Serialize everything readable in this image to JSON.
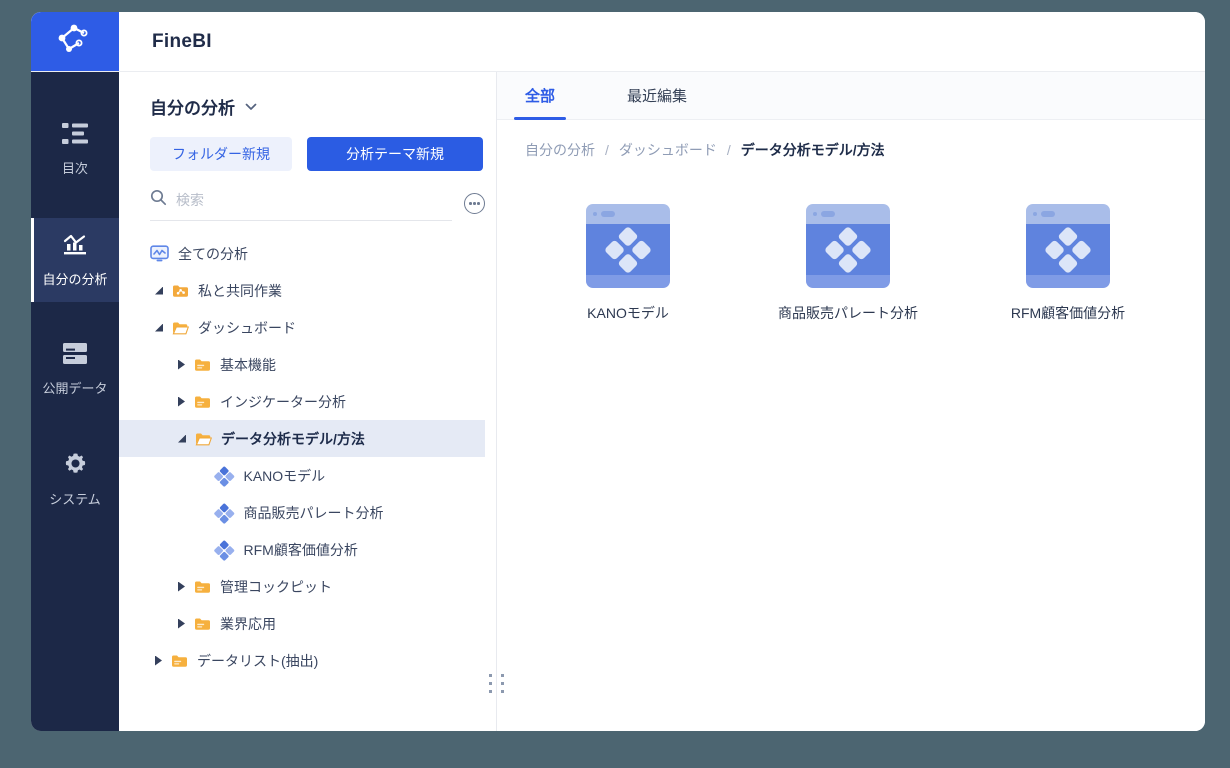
{
  "app": {
    "title": "FineBI"
  },
  "colors": {
    "accent_blue": "#2e5ce6",
    "sidebar_bg": "#1c2847",
    "sidebar_active_bg": "#2b3a63",
    "desktop_bg": "#4c6571",
    "folder_orange": "#f6b03e",
    "selected_row_bg": "#e5eaf5",
    "card_body_blue": "#5f83de"
  },
  "sidebar": {
    "items": [
      {
        "label": "目次",
        "icon": "toc-icon",
        "active": false
      },
      {
        "label": "自分の分析",
        "icon": "my-analysis-chart-icon",
        "active": true
      },
      {
        "label": "公開データ",
        "icon": "public-data-stack-icon",
        "active": false
      },
      {
        "label": "システム",
        "icon": "system-gear-icon",
        "active": false
      }
    ]
  },
  "panel": {
    "title": "自分の分析",
    "new_folder_label": "フォルダー新規",
    "new_theme_label": "分析テーマ新規",
    "search_placeholder": "検索",
    "tree": [
      {
        "label": "全ての分析",
        "level": 0,
        "icon": "monitor-chart-icon",
        "state": "none",
        "selected": false
      },
      {
        "label": "私と共同作業",
        "level": 1,
        "icon": "shared-folder-icon",
        "state": "expanded",
        "selected": false
      },
      {
        "label": "ダッシュボード",
        "level": 1,
        "icon": "folder-open-icon",
        "state": "expanded",
        "selected": false
      },
      {
        "label": "基本機能",
        "level": 2,
        "icon": "folder-icon",
        "state": "collapsed",
        "selected": false
      },
      {
        "label": "インジケーター分析",
        "level": 2,
        "icon": "folder-icon",
        "state": "collapsed",
        "selected": false
      },
      {
        "label": "データ分析モデル/方法",
        "level": 2,
        "icon": "folder-open-icon",
        "state": "expanded",
        "selected": true
      },
      {
        "label": "KANOモデル",
        "level": 3,
        "icon": "analysis-theme-diamond-icon",
        "state": "none",
        "selected": false
      },
      {
        "label": "商品販売パレート分析",
        "level": 3,
        "icon": "analysis-theme-diamond-icon",
        "state": "none",
        "selected": false
      },
      {
        "label": "RFM顧客価値分析",
        "level": 3,
        "icon": "analysis-theme-diamond-icon",
        "state": "none",
        "selected": false
      },
      {
        "label": "管理コックピット",
        "level": 2,
        "icon": "folder-icon",
        "state": "collapsed",
        "selected": false
      },
      {
        "label": "業界応用",
        "level": 2,
        "icon": "folder-icon",
        "state": "collapsed",
        "selected": false
      },
      {
        "label": "データリスト(抽出)",
        "level": 1,
        "icon": "folder-icon",
        "state": "collapsed",
        "selected": false
      }
    ]
  },
  "main": {
    "tabs": [
      {
        "label": "全部",
        "active": true
      },
      {
        "label": "最近編集",
        "active": false
      }
    ],
    "breadcrumb": {
      "items": [
        "自分の分析",
        "ダッシュボード",
        "データ分析モデル/方法"
      ],
      "separator": "/"
    },
    "cards": [
      {
        "label": "KANOモデル"
      },
      {
        "label": "商品販売パレート分析"
      },
      {
        "label": "RFM顧客価値分析"
      }
    ]
  }
}
